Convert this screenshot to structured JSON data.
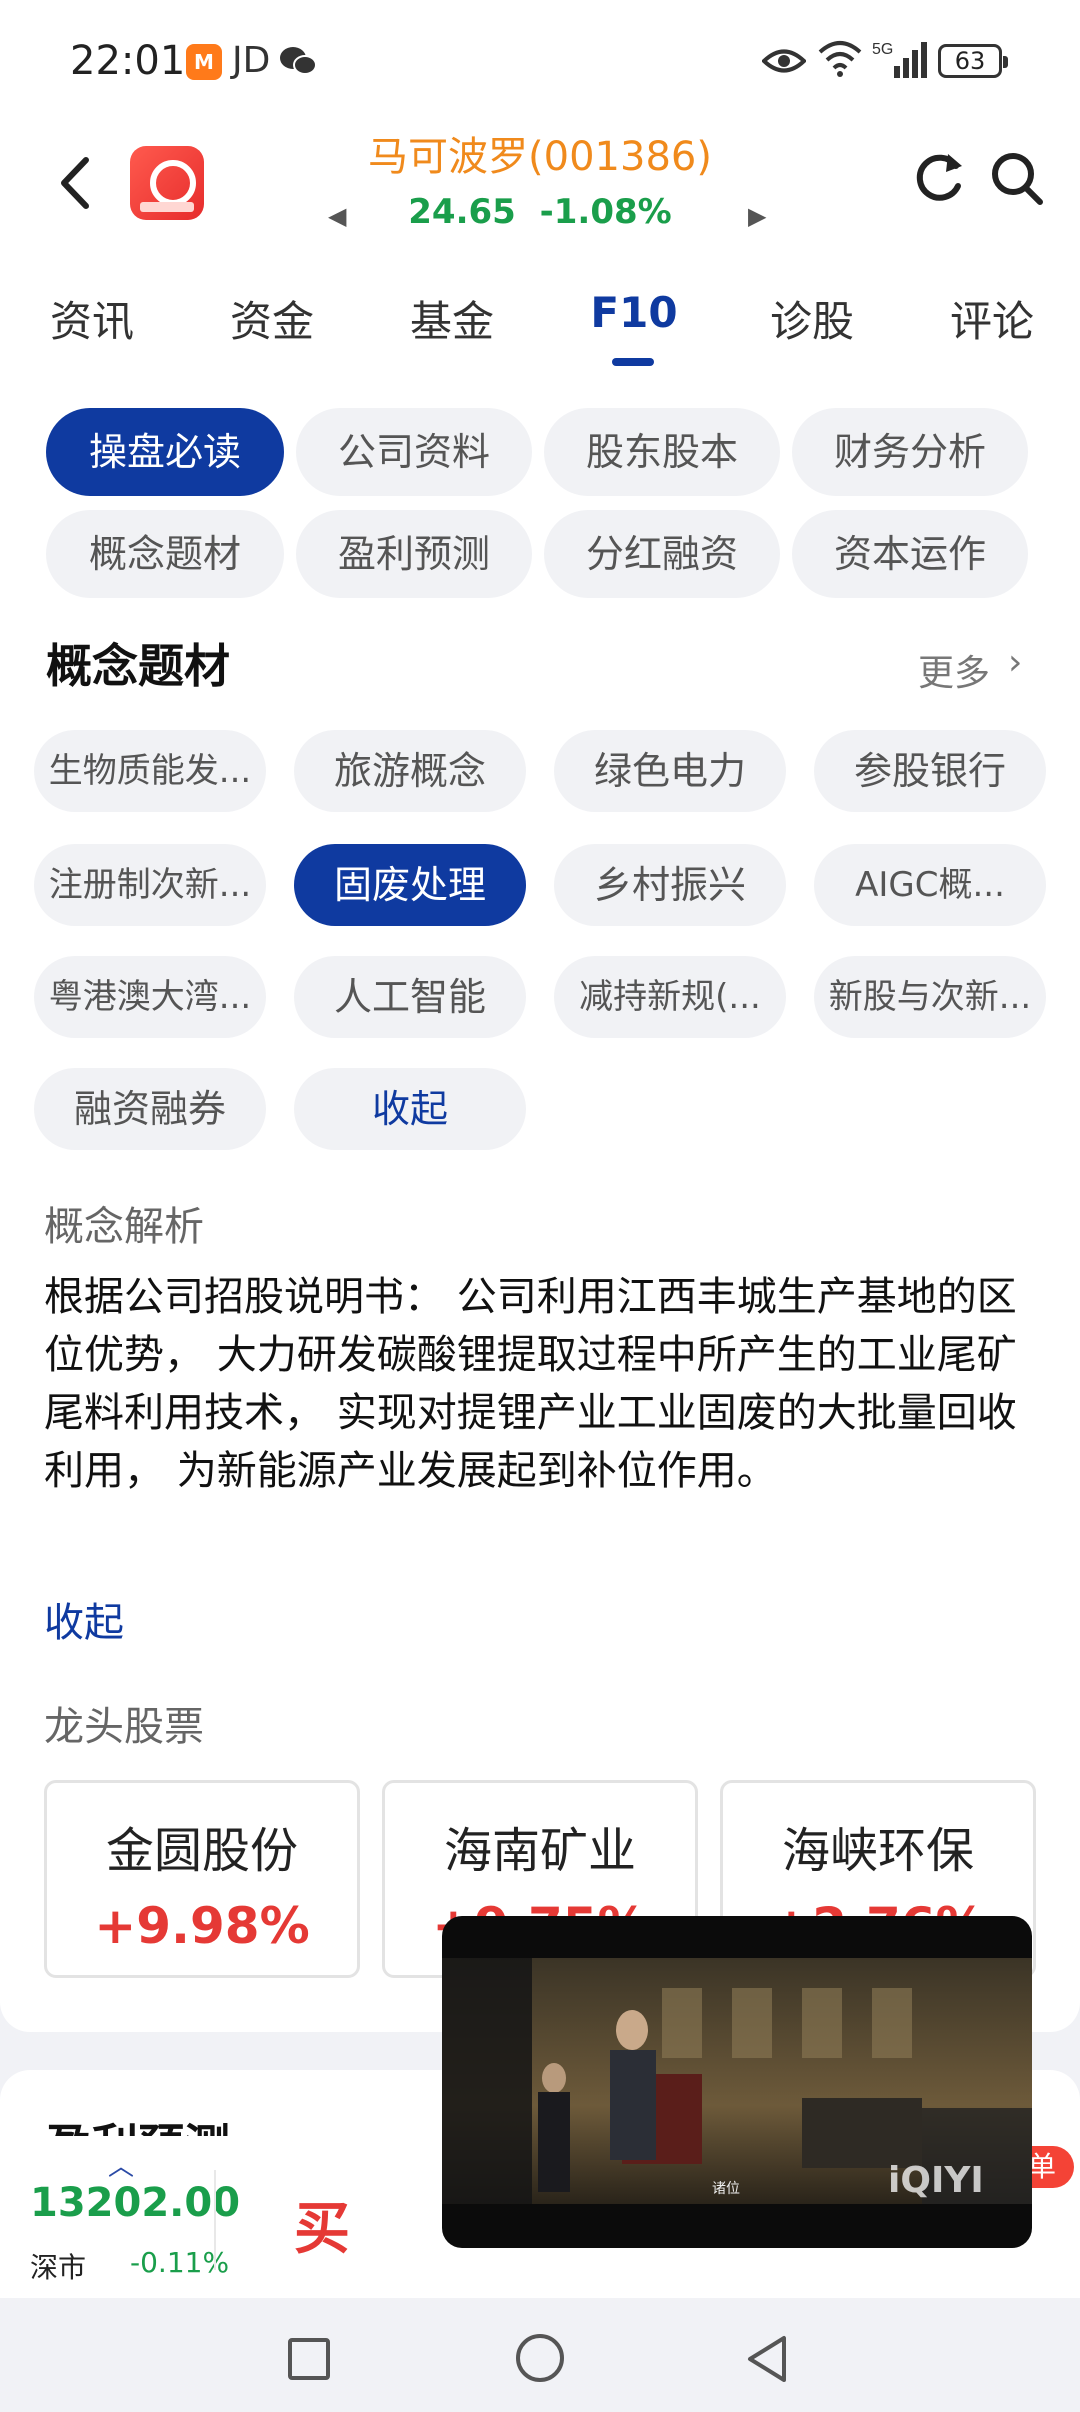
{
  "status_bar": {
    "time": "22:01",
    "app_badge": "M",
    "carrier": "JD",
    "network": "5G",
    "battery": "63"
  },
  "header": {
    "stock_name": "马可波罗(001386)",
    "price": "24.65",
    "change": "-1.08%",
    "prev_arrow": "◀",
    "next_arrow": "▶"
  },
  "main_tabs": [
    "资讯",
    "资金",
    "基金",
    "F10",
    "诊股",
    "评论"
  ],
  "main_tabs_active": "F10",
  "sub_nav": [
    "操盘必读",
    "公司资料",
    "股东股本",
    "财务分析",
    "概念题材",
    "盈利预测",
    "分红融资",
    "资本运作"
  ],
  "sub_nav_active": "操盘必读",
  "concept_section": {
    "title": "概念题材",
    "more": "更多",
    "tags": [
      "生物质能发...",
      "旅游概念",
      "绿色电力",
      "参股银行",
      "注册制次新...",
      "固废处理",
      "乡村振兴",
      "AIGC概...",
      "粤港澳大湾...",
      "人工智能",
      "减持新规(...",
      "新股与次新...",
      "融资融券"
    ],
    "active_tag": "固废处理",
    "collapse": "收起"
  },
  "concept_analysis": {
    "label": "概念解析",
    "text": "根据公司招股说明书： 公司利用江西丰城生产基地的区位优势， 大力研发碳酸锂提取过程中所产生的工业尾矿尾料利用技术， 实现对提锂产业工业固废的大批量回收利用， 为新能源产业发展起到补位作用。",
    "collapse": "收起"
  },
  "leaders": {
    "label": "龙头股票",
    "items": [
      {
        "name": "金圆股份",
        "change": "+9.98%"
      },
      {
        "name": "海南矿业",
        "change": "+9.75%"
      },
      {
        "name": "海峡环保",
        "change": "+2.76%"
      }
    ]
  },
  "next_section": {
    "title": "盈利预测"
  },
  "bottom_bar": {
    "index_value": "13202.00",
    "index_name": "深市",
    "index_change": "-0.11%",
    "buy": "买",
    "badge": "单"
  },
  "video": {
    "subtitle": "诸位",
    "brand": "iQIYI"
  },
  "colors": {
    "accent": "#0f3aa0",
    "up": "#e53935",
    "down": "#1a9e4b",
    "stock_name": "#f08a1c"
  }
}
